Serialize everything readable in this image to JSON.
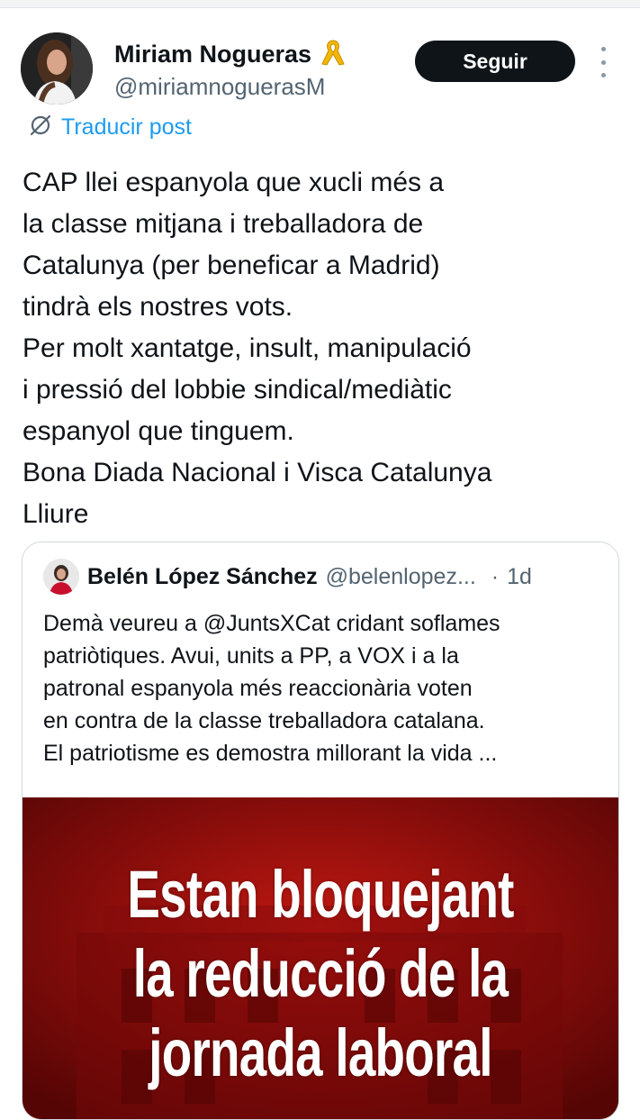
{
  "post": {
    "author_name": "Miriam Nogueras",
    "author_badge_icon": "yellow-ribbon-icon",
    "author_handle": "@miriamnoguerasM",
    "follow_label": "Seguir",
    "translate_label": "Traducir post",
    "text_lines": [
      "CAP llei espanyola que xucli més a",
      "la classe mitjana i treballadora de",
      "Catalunya (per beneficar a Madrid)",
      "tindrà els nostres vots.",
      "Per molt xantatge, insult, manipulació",
      "i pressió del lobbie sindical/mediàtic",
      "espanyol que tinguem.",
      "Bona Diada Nacional i Visca Catalunya",
      "Lliure"
    ]
  },
  "quote": {
    "author_name": "Belén López Sánchez",
    "author_handle": "@belenlopez...",
    "separator": "·",
    "time": "1d",
    "text_lines": [
      "Demà veureu a @JuntsXCat  cridant soflames",
      "patriòtiques. Avui, units a PP, a VOX i a la",
      "patronal espanyola més reaccionària voten",
      "en contra de la classe treballadora catalana.",
      "El patriotisme es demostra millorant la vida ..."
    ],
    "image_headline": [
      "Estan bloquejant",
      "la reducció de la",
      "jornada laboral"
    ]
  },
  "colors": {
    "accent": "#1d9bf0",
    "follow_bg": "#0f1419",
    "secondary_text": "#536471",
    "image_red": "#b10d0d",
    "ribbon": "#f2b705"
  }
}
